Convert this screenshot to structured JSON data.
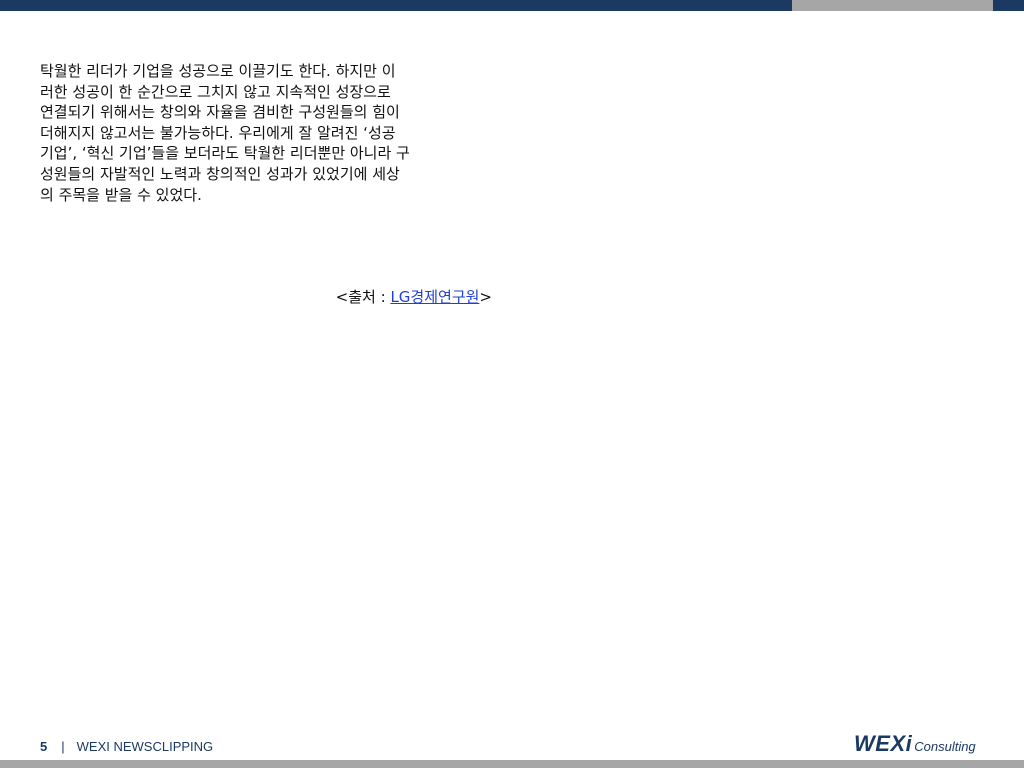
{
  "body": {
    "paragraph": " 탁월한 리더가 기업을 성공으로 이끌기도 한다. 하지만 이\n러한 성공이 한 순간으로 그치지 않고 지속적인 성장으로\n연결되기 위해서는 창의와 자율을 겸비한 구성원들의 힘이\n더해지지 않고서는 불가능하다. 우리에게 잘 알려진 ‘성공\n기업’, ‘혁신 기업’들을 보더라도 탁월한 리더뿐만 아니라 구\n성원들의 자발적인 노력과 창의적인 성과가 있었기에 세상\n의 주목을 받을 수 있었다."
  },
  "source": {
    "prefix": "<출처 : ",
    "link_text": "LG경제연구원",
    "suffix": ">"
  },
  "footer": {
    "page_number": "5",
    "separator": "|",
    "label": "WEXI NEWSCLIPPING"
  },
  "logo": {
    "main": "WEXi",
    "sub": "Consulting"
  },
  "colors": {
    "brand_navy": "#1b3a63",
    "accent_gray": "#a6a6a6",
    "link_blue": "#1f3fd6"
  }
}
